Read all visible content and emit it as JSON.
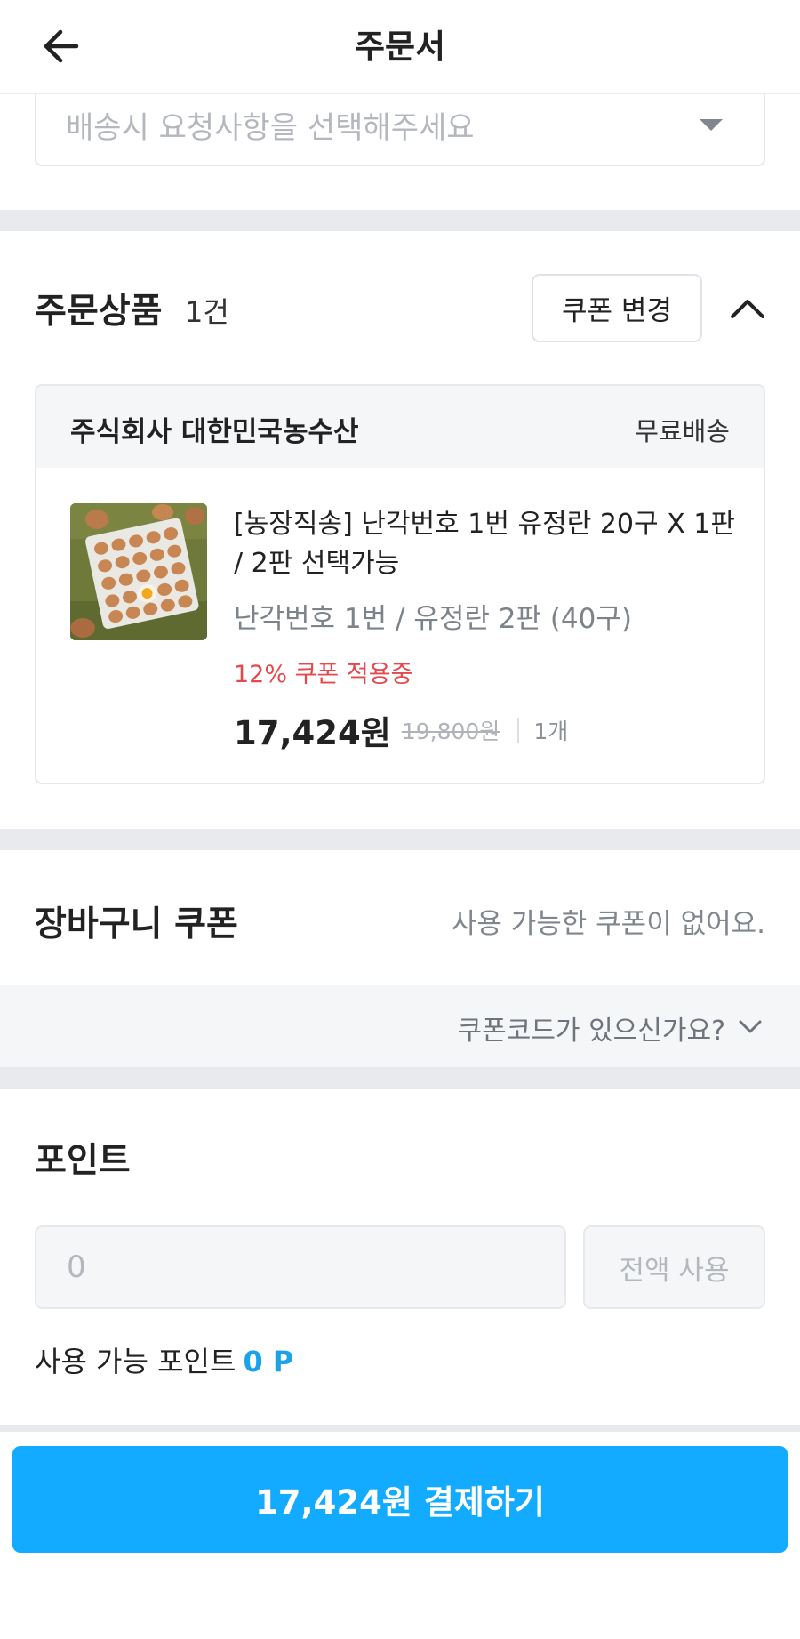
{
  "header": {
    "title": "주문서"
  },
  "delivery_request": {
    "placeholder": "배송시 요청사항을 선택해주세요"
  },
  "order_products": {
    "title": "주문상품",
    "count": "1건",
    "coupon_change_label": "쿠폰 변경",
    "seller": {
      "name": "주식회사 대한민국농수산",
      "shipping": "무료배송"
    },
    "item": {
      "name": "[농장직송] 난각번호 1번 유정란 20구 X 1판 / 2판 선택가능",
      "option": "난각번호 1번 / 유정란 2판 (40구)",
      "coupon_applied": "12% 쿠폰 적용중",
      "final_price": "17,424원",
      "original_price": "19,800원",
      "quantity": "1개"
    }
  },
  "basket_coupon": {
    "title": "장바구니 쿠폰",
    "note": "사용 가능한 쿠폰이 없어요.",
    "code_prompt": "쿠폰코드가 있으신가요?"
  },
  "points": {
    "title": "포인트",
    "input_placeholder": "0",
    "use_all_label": "전액 사용",
    "available_label": "사용 가능 포인트",
    "available_value": "0 P"
  },
  "pay_button_label": "17,424원 결제하기",
  "colors": {
    "primary": "#13abff",
    "coupon_red": "#e5484d",
    "point_blue": "#1aa3e8",
    "section_divider": "#e8eaed"
  },
  "icons": {
    "back": "arrow-left-icon",
    "select_caret": "caret-down-icon",
    "collapse": "chevron-up-icon",
    "coupon_code_expand": "chevron-down-icon"
  }
}
